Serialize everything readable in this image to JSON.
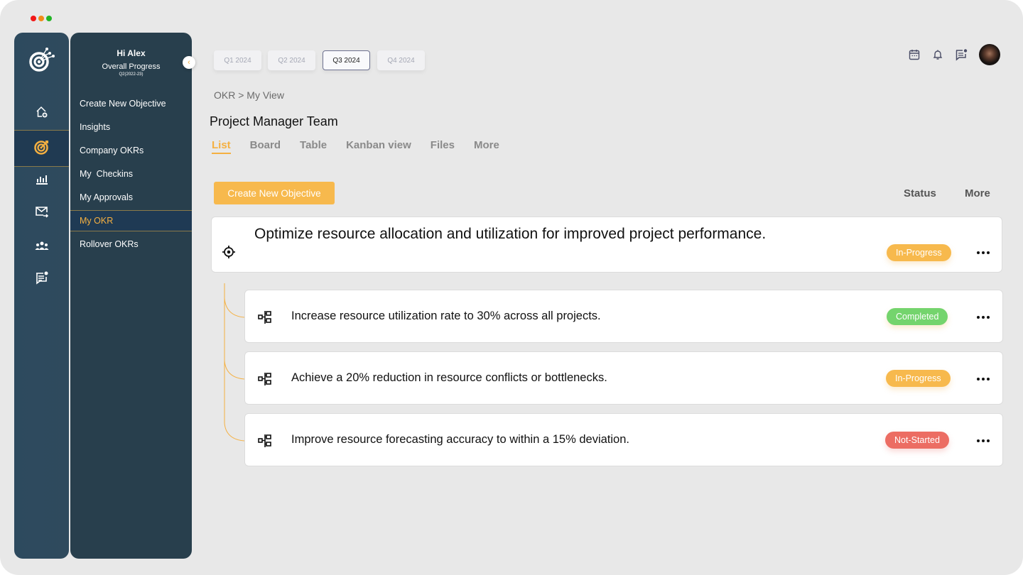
{
  "window": {
    "traffic_lights": [
      "#f21818",
      "#f08c1a",
      "#22b526"
    ]
  },
  "rail": {
    "logo": "target-network-logo",
    "items": [
      {
        "icon": "home-add-icon",
        "active": false
      },
      {
        "icon": "target-icon",
        "active": true
      },
      {
        "icon": "bar-chart-icon",
        "active": false
      },
      {
        "icon": "mail-forward-icon",
        "active": false
      },
      {
        "icon": "team-icon",
        "active": false
      },
      {
        "icon": "chat-notification-icon",
        "active": false
      }
    ]
  },
  "menu": {
    "greeting": "Hi Alex",
    "progress_label": "Overall Progress",
    "period": "Q2(2022-23)",
    "items": [
      {
        "label": "Create New Objective",
        "active": false
      },
      {
        "label": "Insights",
        "active": false
      },
      {
        "label": "Company OKRs",
        "active": false
      },
      {
        "label": "My  Checkins",
        "active": false
      },
      {
        "label": "My Approvals",
        "active": false
      },
      {
        "label": "My OKR",
        "active": true
      },
      {
        "label": "Rollover OKRs",
        "active": false
      }
    ]
  },
  "quarters": [
    {
      "label": "Q1 2024",
      "active": false
    },
    {
      "label": "Q2 2024",
      "active": false
    },
    {
      "label": "Q3 2024",
      "active": true
    },
    {
      "label": "Q4 2024",
      "active": false
    }
  ],
  "header_icons": [
    "calendar-icon",
    "bell-icon",
    "chat-icon",
    "avatar"
  ],
  "breadcrumb": "OKR > My View",
  "page_title": "Project Manager Team",
  "view_tabs": [
    {
      "label": "List",
      "active": true
    },
    {
      "label": "Board",
      "active": false
    },
    {
      "label": "Table",
      "active": false
    },
    {
      "label": "Kanban view",
      "active": false
    },
    {
      "label": "Files",
      "active": false
    },
    {
      "label": "More",
      "active": false
    }
  ],
  "toolbar": {
    "create_label": "Create New Objective",
    "status_label": "Status",
    "more_label": "More"
  },
  "colors": {
    "accent": "#f5b041",
    "in_progress": "#f7b94d",
    "completed": "#74d46d",
    "not_started": "#ec6d63",
    "sidebar": "#283f4d"
  },
  "objective": {
    "text": "Optimize resource allocation and utilization for improved project performance.",
    "status": "In-Progress",
    "icon": "crosshair-target-icon"
  },
  "key_results": [
    {
      "text": "Increase resource utilization rate to 30% across all projects.",
      "status": "Completed",
      "icon": "hierarchy-icon"
    },
    {
      "text": "Achieve a 20% reduction in resource conflicts or bottlenecks.",
      "status": "In-Progress",
      "icon": "hierarchy-icon"
    },
    {
      "text": "Improve resource forecasting accuracy to within a 15% deviation.",
      "status": "Not-Started",
      "icon": "hierarchy-icon"
    }
  ]
}
